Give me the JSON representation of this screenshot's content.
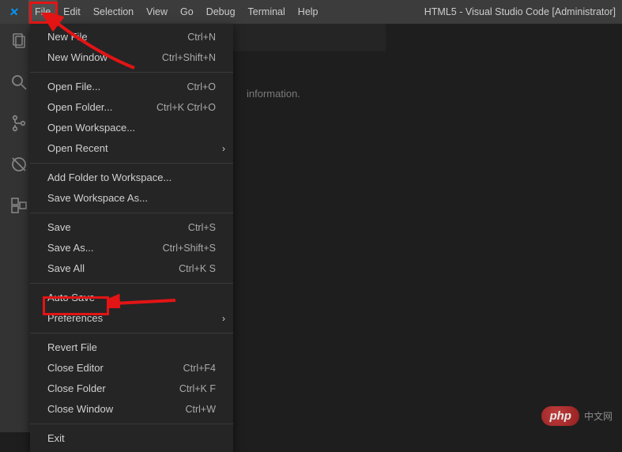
{
  "titlebar": {
    "menus": [
      "File",
      "Edit",
      "Selection",
      "View",
      "Go",
      "Debug",
      "Terminal",
      "Help"
    ],
    "title": "HTML5 - Visual Studio Code [Administrator]"
  },
  "dropdown": {
    "groups": [
      [
        {
          "label": "New File",
          "shortcut": "Ctrl+N"
        },
        {
          "label": "New Window",
          "shortcut": "Ctrl+Shift+N"
        }
      ],
      [
        {
          "label": "Open File...",
          "shortcut": "Ctrl+O"
        },
        {
          "label": "Open Folder...",
          "shortcut": "Ctrl+K Ctrl+O"
        },
        {
          "label": "Open Workspace..."
        },
        {
          "label": "Open Recent",
          "submenu": true
        }
      ],
      [
        {
          "label": "Add Folder to Workspace..."
        },
        {
          "label": "Save Workspace As..."
        }
      ],
      [
        {
          "label": "Save",
          "shortcut": "Ctrl+S"
        },
        {
          "label": "Save As...",
          "shortcut": "Ctrl+Shift+S"
        },
        {
          "label": "Save All",
          "shortcut": "Ctrl+K S"
        }
      ],
      [
        {
          "label": "Auto Save"
        },
        {
          "label": "Preferences",
          "submenu": true
        }
      ],
      [
        {
          "label": "Revert File"
        },
        {
          "label": "Close Editor",
          "shortcut": "Ctrl+F4"
        },
        {
          "label": "Close Folder",
          "shortcut": "Ctrl+K F"
        },
        {
          "label": "Close Window",
          "shortcut": "Ctrl+W"
        }
      ],
      [
        {
          "label": "Exit"
        }
      ]
    ]
  },
  "editor": {
    "info_text": "information."
  },
  "watermark": {
    "badge": "php",
    "text": "中文网"
  }
}
